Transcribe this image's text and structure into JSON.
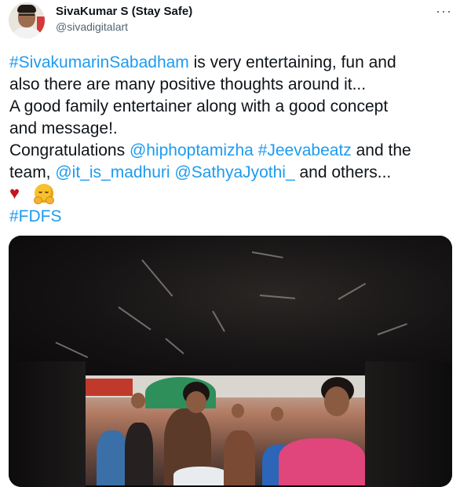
{
  "author": {
    "display_name": "SivaKumar S (Stay Safe)",
    "handle": "@sivadigitalart",
    "avatar_icon": "profile-photo"
  },
  "more_menu": {
    "label": "···",
    "icon": "more-icon"
  },
  "tweet": {
    "line1": {
      "hashtag": "#SivakumarinSabadham",
      "rest": " is very entertaining, fun and"
    },
    "line2": "also there are many positive thoughts around it...",
    "line3": "A good family entertainer along with a good concept",
    "line4": "and message!.",
    "line5": {
      "prefix": "Congratulations ",
      "mention1": "@hiphoptamizha",
      "space": " ",
      "hashtag2": "#Jeevabeatz",
      "suffix": " and the"
    },
    "line6": {
      "prefix": "team, ",
      "mention2": "@it_is_madhuri",
      "space": " ",
      "mention3": "@SathyaJyothi_",
      "suffix": " and others..."
    },
    "emojis": {
      "heart": "♥",
      "heart_icon": "red-heart-icon",
      "hug_icon": "hugging-face-icon"
    },
    "hashtag3": "#FDFS"
  },
  "colors": {
    "link": "#1d9bf0",
    "text": "#0f1419",
    "secondary": "#536471",
    "heart": "#c4141d"
  },
  "media": {
    "type": "image",
    "subject_icon": "cinema-screen-photo"
  }
}
